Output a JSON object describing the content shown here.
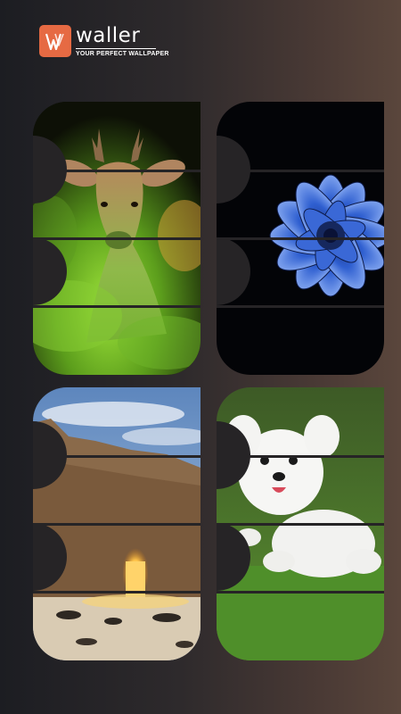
{
  "app": {
    "name": "waller",
    "tagline": "YOUR PERFECT WALLPAPER",
    "brand_color": "#e66a43"
  },
  "wallpapers": [
    {
      "subject": "deer",
      "label": "Deer in green smoke"
    },
    {
      "subject": "flower",
      "label": "Blue dahlia"
    },
    {
      "subject": "rock-arch",
      "label": "Rock arch at sunset"
    },
    {
      "subject": "dog",
      "label": "White puppy on grass"
    }
  ],
  "colors": {
    "background_left": "#1c1d22",
    "background_right": "#5a463c",
    "deer_glow": "#8ed62f",
    "flower_blue": "#2f5fd0",
    "sky_blue": "#6d94c6",
    "grass_green": "#4f8f2a"
  }
}
